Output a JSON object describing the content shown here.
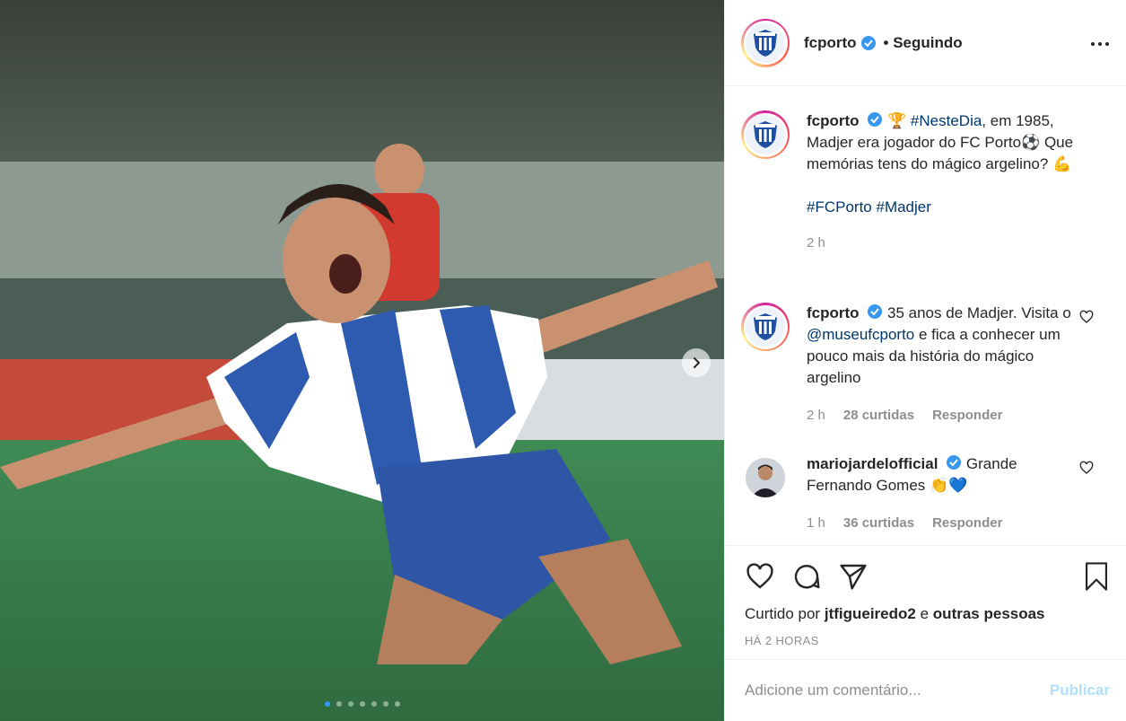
{
  "post": {
    "author": "fcporto",
    "follow_state": "• Seguindo",
    "caption": {
      "emoji_trophy": "🏆",
      "hashtag1": "#NesteDia",
      "text1": ", em 1985, Madjer era jogador do FC Porto⚽ Que memórias tens do mágico argelino? 💪",
      "hashtag2": "#FCPorto",
      "hashtag3": "#Madjer",
      "time": "2 h"
    },
    "slides": {
      "count": 7,
      "active": 1
    }
  },
  "comments": [
    {
      "user": "fcporto",
      "text_pre": "35 anos de Madjer. Visita o ",
      "mention": "@museufcporto",
      "text_post": " e fica a conhecer um pouco mais da história do mágico argelino",
      "time": "2 h",
      "likes": "28 curtidas",
      "reply": "Responder"
    },
    {
      "user": "mariojardelofficial",
      "text_pre": "Grande Fernando Gomes 👏💙",
      "time": "1 h",
      "likes": "36 curtidas",
      "reply": "Responder"
    }
  ],
  "likes_line": {
    "prefix": "Curtido por",
    "user": "jtfigueiredo2",
    "middle": "e",
    "others": "outras pessoas"
  },
  "timestamp": "HÁ 2 HORAS",
  "add_comment": {
    "placeholder": "Adicione um comentário...",
    "publish": "Publicar"
  },
  "icons": {
    "verified": "verified-badge-icon",
    "more": "more-options-icon",
    "like": "heart-icon",
    "comment": "comment-bubble-icon",
    "share": "paper-plane-icon",
    "save": "bookmark-icon",
    "next": "chevron-right-icon"
  },
  "colors": {
    "verified": "#3897f0",
    "link": "#00376b",
    "publish": "#b2dffc",
    "muted": "#8e8e8e"
  }
}
